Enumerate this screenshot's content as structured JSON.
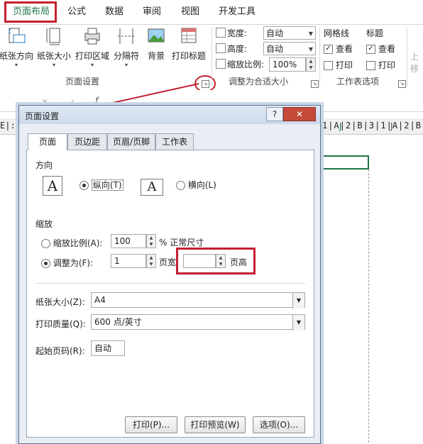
{
  "ribbon": {
    "tabs": [
      "页面布局",
      "公式",
      "数据",
      "审阅",
      "视图",
      "开发工具"
    ],
    "buttons": [
      {
        "label": "纸张方向",
        "icon": "orientation-icon"
      },
      {
        "label": "纸张大小",
        "icon": "page-size-icon"
      },
      {
        "label": "打印区域",
        "icon": "print-area-icon"
      },
      {
        "label": "分隔符",
        "icon": "breaks-icon"
      },
      {
        "label": "背景",
        "icon": "background-icon"
      },
      {
        "label": "打印标题",
        "icon": "print-titles-icon"
      }
    ],
    "group_page_setup": "页面设置",
    "scale": {
      "width_label": "宽度:",
      "width_value": "自动",
      "height_label": "高度:",
      "height_value": "自动",
      "scale_label": "缩放比例:",
      "scale_value": "100%",
      "group_label": "调整为合适大小"
    },
    "gridlines": {
      "title": "网格线",
      "view": "查看",
      "print": "打印"
    },
    "headings": {
      "title": "标题",
      "view": "查看",
      "print": "打印"
    },
    "sheet_options_label": "工作表选项",
    "cut_off": "上移"
  },
  "sheet": {
    "col_labels": [
      "1",
      "A",
      "2",
      "B",
      "3",
      "1",
      "A",
      "2",
      "B",
      "3"
    ],
    "left_fragment": "E|:|1",
    "col_j": "J",
    "formula_fx": "f"
  },
  "dialog": {
    "title": "页面设置",
    "help": "?",
    "close": "✕",
    "tabs": [
      "页面",
      "页边距",
      "页眉/页脚",
      "工作表"
    ],
    "orientation": {
      "section": "方向",
      "portrait": "纵向(T)",
      "landscape": "横向(L)",
      "glyph": "A"
    },
    "scaling": {
      "section": "缩放",
      "adjust_label": "缩放比例(A):",
      "adjust_value": "100",
      "adjust_suffix": "% 正常尺寸",
      "fit_label": "调整为(F):",
      "fit_wide_value": "1",
      "fit_wide_suffix": "页宽",
      "fit_tall_value": "",
      "fit_tall_suffix": "页高"
    },
    "paper_size": {
      "label": "纸张大小(Z):",
      "value": "A4"
    },
    "print_quality": {
      "label": "打印质量(Q):",
      "value": "600 点/英寸"
    },
    "first_page": {
      "label": "起始页码(R):",
      "value": "自动"
    },
    "buttons": {
      "print": "打印(P)...",
      "preview": "打印预览(W)",
      "options": "选项(O)..."
    }
  },
  "colors": {
    "highlight": "#c42030",
    "accent": "#217346"
  }
}
